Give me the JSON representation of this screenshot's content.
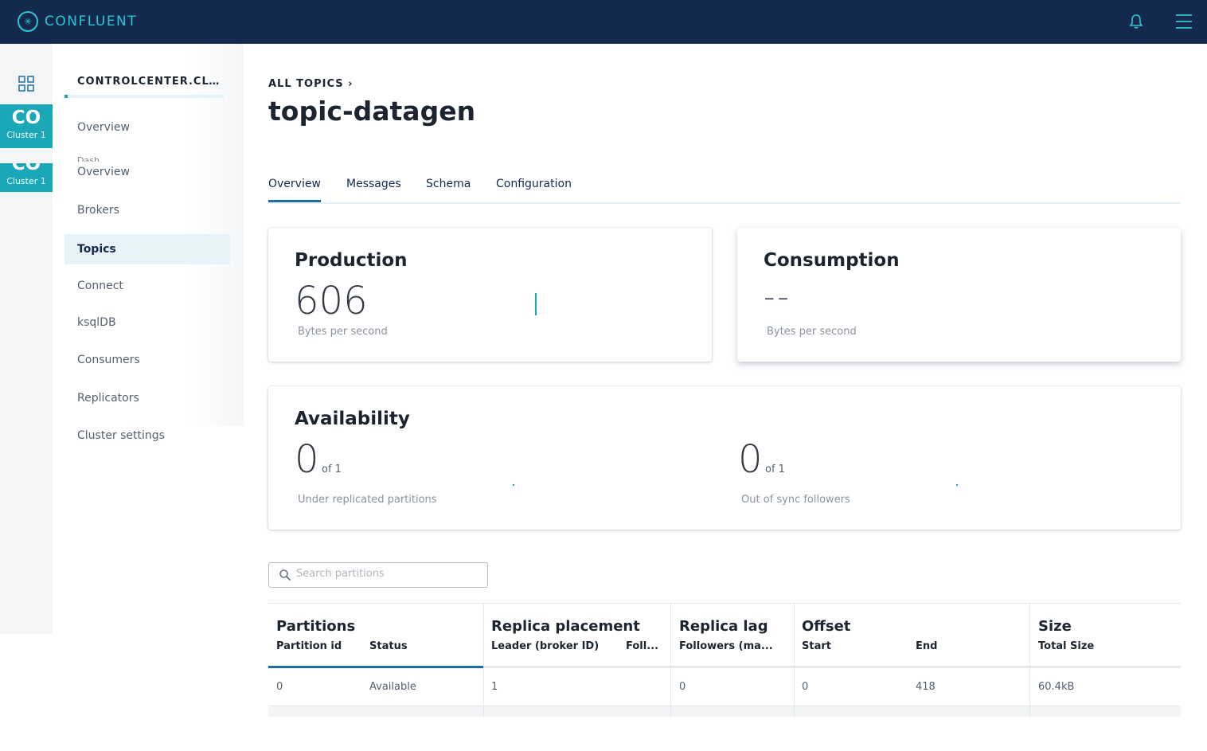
{
  "header": {
    "brand": "CONFLUENT"
  },
  "rail": {
    "clusters": [
      {
        "abbr": "CO",
        "name": "Cluster 1"
      },
      {
        "abbr": "CO",
        "name": "Cluster 1"
      }
    ]
  },
  "nav": {
    "cluster_title": "CONTROLCENTER.CLU...",
    "ghost": "Dash",
    "items": [
      "Overview",
      "Overview",
      "Brokers",
      "Topics",
      "Connect",
      "ksqlDB",
      "Consumers",
      "Replicators",
      "Cluster settings"
    ],
    "active": "Topics"
  },
  "page": {
    "breadcrumb": "ALL TOPICS",
    "breadcrumb_sep": "›",
    "title": "topic-datagen"
  },
  "tabs": [
    "Overview",
    "Messages",
    "Schema",
    "Configuration"
  ],
  "production": {
    "title": "Production",
    "value": "606",
    "unit": "Bytes per second"
  },
  "consumption": {
    "title": "Consumption",
    "value": "--",
    "unit": "Bytes per second"
  },
  "availability": {
    "title": "Availability",
    "under_replicated": {
      "value": "0",
      "of": "of 1",
      "label": "Under replicated partitions"
    },
    "out_of_sync": {
      "value": "0",
      "of": "of 1",
      "label": "Out of sync followers"
    }
  },
  "search": {
    "placeholder": "Search partitions"
  },
  "table": {
    "groups": {
      "partitions": {
        "title": "Partitions",
        "cols": [
          "Partition id",
          "Status"
        ]
      },
      "replica_placement": {
        "title": "Replica placement",
        "cols": [
          "Leader (broker ID)",
          "Foll..."
        ]
      },
      "replica_lag": {
        "title": "Replica lag",
        "cols": [
          "Followers (ma..."
        ]
      },
      "offset": {
        "title": "Offset",
        "cols": [
          "Start",
          "End"
        ]
      },
      "size": {
        "title": "Size",
        "cols": [
          "Total Size"
        ]
      }
    },
    "rows": [
      {
        "partition_id": "0",
        "status": "Available",
        "leader": "1",
        "lag": "0",
        "start": "0",
        "end": "418",
        "size": "60.4kB"
      }
    ]
  },
  "colors": {
    "topbar": "#132a4e",
    "accent": "#1aa8b8",
    "tab_active": "#1a6fa0"
  }
}
